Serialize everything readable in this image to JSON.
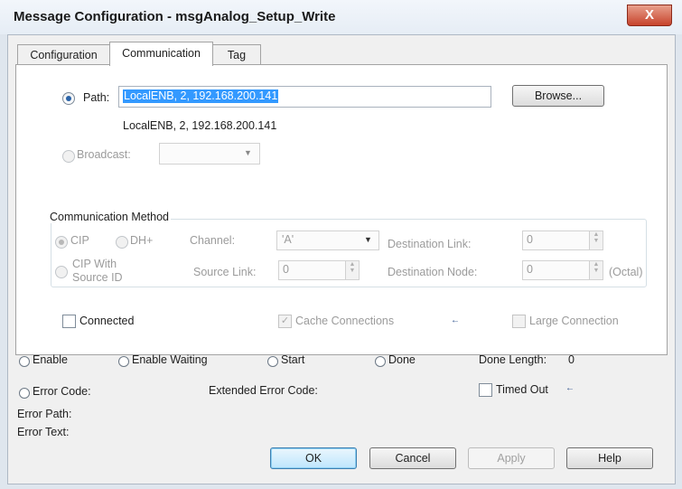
{
  "window": {
    "title": "Message Configuration - msgAnalog_Setup_Write",
    "close_glyph": "X"
  },
  "tabs": [
    {
      "label": "Configuration",
      "active": false
    },
    {
      "label": "Communication",
      "active": true
    },
    {
      "label": "Tag",
      "active": false
    }
  ],
  "communication": {
    "path_label": "Path:",
    "path_value": "LocalENB, 2, 192.168.200.141",
    "path_resolved": "LocalENB, 2, 192.168.200.141",
    "browse_label": "Browse...",
    "broadcast_label": "Broadcast:",
    "broadcast_value": "",
    "method": {
      "group_title": "Communication Method",
      "cip_label": "CIP",
      "dhplus_label": "DH+",
      "channel_label": "Channel:",
      "channel_value": "'A'",
      "destination_link_label": "Destination Link:",
      "destination_link_value": "0",
      "cip_source_id_label_1": "CIP With",
      "cip_source_id_label_2": "Source ID",
      "source_link_label": "Source Link:",
      "source_link_value": "0",
      "destination_node_label": "Destination Node:",
      "destination_node_value": "0",
      "octal_label": "(Octal)"
    },
    "connected_label": "Connected",
    "cache_connections_label": "Cache Connections",
    "large_connection_label": "Large Connection"
  },
  "status": {
    "enable_label": "Enable",
    "enable_waiting_label": "Enable Waiting",
    "start_label": "Start",
    "done_label": "Done",
    "done_length_label": "Done Length:",
    "done_length_value": "0",
    "error_code_label": "Error Code:",
    "extended_error_code_label": "Extended Error Code:",
    "timed_out_label": "Timed Out",
    "error_path_label": "Error Path:",
    "error_text_label": "Error Text:"
  },
  "buttons": {
    "ok": "OK",
    "cancel": "Cancel",
    "apply": "Apply",
    "help": "Help"
  },
  "icons": {
    "arrow_glyph": "←",
    "check_glyph": "✓",
    "down_glyph": "▼",
    "spin_up": "▲",
    "spin_down": "▼"
  },
  "colors": {
    "selection_highlight": "#3399ff",
    "title_bar": "#e6edf5",
    "close_button": "#c7432c"
  }
}
